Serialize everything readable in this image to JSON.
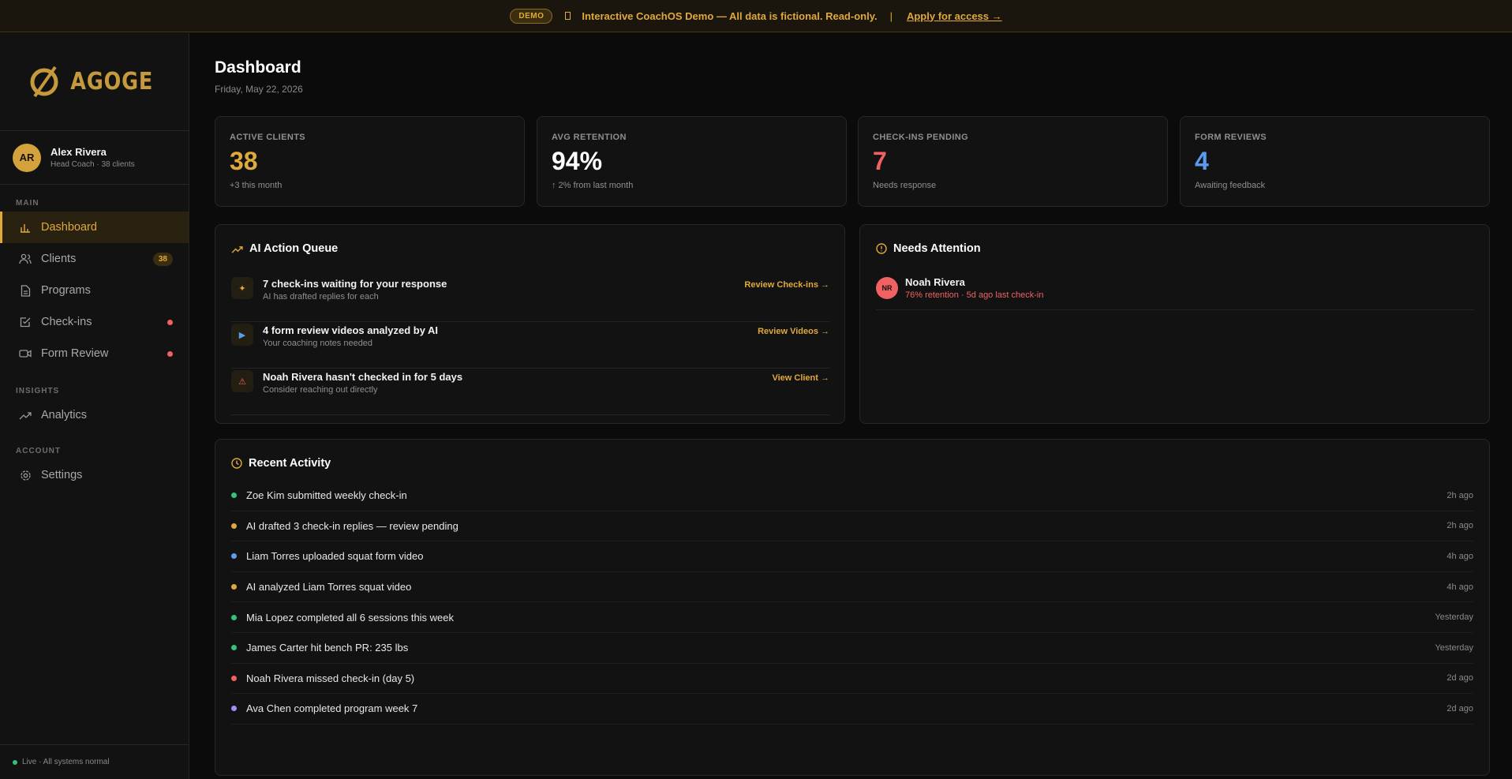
{
  "banner": {
    "pill": "DEMO",
    "text": "Interactive CoachOS Demo — All data is fictional. Read-only.",
    "separator": "|",
    "link": "Apply for access →"
  },
  "brand": {
    "logo_text": "AGOGE"
  },
  "user": {
    "initials": "AR",
    "name": "Alex Rivera",
    "subtitle": "Head Coach · 38 clients"
  },
  "nav": {
    "sections": [
      "MAIN",
      "INSIGHTS",
      "ACCOUNT"
    ],
    "items": [
      {
        "label": "Dashboard",
        "icon": "bar-chart-icon"
      },
      {
        "label": "Clients",
        "icon": "users-icon",
        "badge": "38"
      },
      {
        "label": "Programs",
        "icon": "document-icon"
      },
      {
        "label": "Check-ins",
        "icon": "checklist-icon"
      },
      {
        "label": "Form Review",
        "icon": "video-icon"
      },
      {
        "label": "Analytics",
        "icon": "trend-icon"
      },
      {
        "label": "Settings",
        "icon": "gear-icon"
      }
    ]
  },
  "footer": {
    "status": "Live · All systems normal"
  },
  "page": {
    "title": "Dashboard",
    "date": "Friday, May 22, 2026"
  },
  "stats": [
    {
      "label": "ACTIVE CLIENTS",
      "value": "38",
      "sub": "+3 this month",
      "color": "#e0a93b"
    },
    {
      "label": "AVG RETENTION",
      "value": "94%",
      "sub": "↑ 2% from last month",
      "color": "#ffffff"
    },
    {
      "label": "CHECK-INS PENDING",
      "value": "7",
      "sub": "Needs response",
      "color": "#f06262"
    },
    {
      "label": "FORM REVIEWS",
      "value": "4",
      "sub": "Awaiting feedback",
      "color": "#5b9cf0"
    }
  ],
  "queue": {
    "title": "AI Action Queue",
    "items": [
      {
        "icon": "✦",
        "title": "7 check-ins waiting for your response",
        "sub": "AI has drafted replies for each",
        "action": "Review Check-ins →"
      },
      {
        "icon": "▶",
        "title": "4 form review videos analyzed by AI",
        "sub": "Your coaching notes needed",
        "action": "Review Videos →"
      },
      {
        "icon": "⚠",
        "title": "Noah Rivera hasn't checked in for 5 days",
        "sub": "Consider reaching out directly",
        "action": "View Client →"
      }
    ]
  },
  "attention": {
    "title": "Needs Attention",
    "items": [
      {
        "initials": "NR",
        "name": "Noah Rivera",
        "sub": "76% retention · 5d ago last check-in"
      }
    ]
  },
  "activity": {
    "title": "Recent Activity",
    "items": [
      {
        "text": "Zoe Kim submitted weekly check-in",
        "time": "2h ago",
        "color": "#34c27a"
      },
      {
        "text": "AI drafted 3 check-in replies — review pending",
        "time": "2h ago",
        "color": "#e0a93b"
      },
      {
        "text": "Liam Torres uploaded squat form video",
        "time": "4h ago",
        "color": "#5b9cf0"
      },
      {
        "text": "AI analyzed Liam Torres squat video",
        "time": "4h ago",
        "color": "#e0a93b"
      },
      {
        "text": "Mia Lopez completed all 6 sessions this week",
        "time": "Yesterday",
        "color": "#34c27a"
      },
      {
        "text": "James Carter hit bench PR: 235 lbs",
        "time": "Yesterday",
        "color": "#34c27a"
      },
      {
        "text": "Noah Rivera missed check-in (day 5)",
        "time": "2d ago",
        "color": "#f06262"
      },
      {
        "text": "Ava Chen completed program week 7",
        "time": "2d ago",
        "color": "#a68cf5"
      }
    ]
  }
}
